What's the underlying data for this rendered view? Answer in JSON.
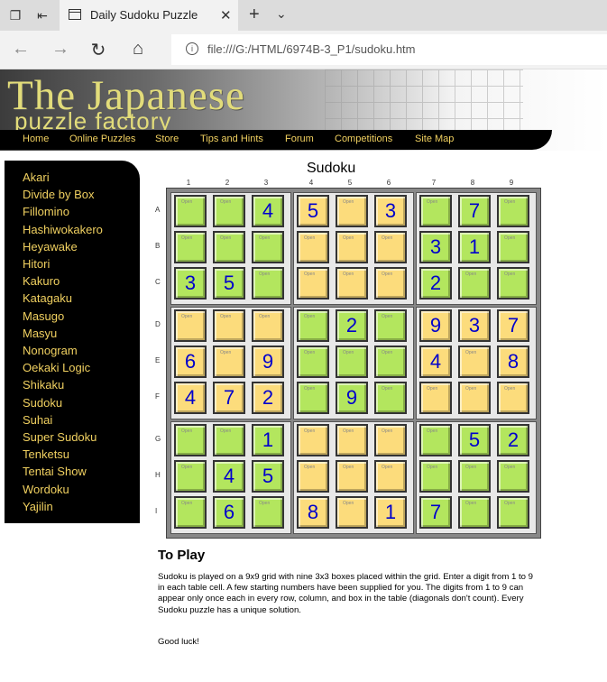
{
  "browser": {
    "tab_title": "Daily Sudoku Puzzle",
    "url": "file:///G:/HTML/6974B-3_P1/sudoku.htm",
    "icons": [
      "tab-actions-icon",
      "set-aside-tabs-icon",
      "page-icon",
      "close-icon",
      "plus-icon",
      "chevron-down-icon",
      "back-arrow-icon",
      "forward-arrow-icon",
      "refresh-icon",
      "home-icon",
      "info-icon"
    ]
  },
  "banner": {
    "title_line1": "The Japanese",
    "title_line2": "puzzle factory"
  },
  "menu": [
    "Home",
    "Online Puzzles",
    "Store",
    "Tips and Hints",
    "Forum",
    "Competitions",
    "Site Map"
  ],
  "sidebar": {
    "items": [
      "Akari",
      "Divide by Box",
      "Fillomino",
      "Hashiwokakero",
      "Heyawake",
      "Hitori",
      "Kakuro",
      "Katagaku",
      "Masugo",
      "Masyu",
      "Nonogram",
      "Oekaki Logic",
      "Shikaku",
      "Sudoku",
      "Suhai",
      "Super Sudoku",
      "Tenketsu",
      "Tentai Show",
      "Wordoku",
      "Yajilin"
    ]
  },
  "puzzle": {
    "title": "Sudoku",
    "column_headers": [
      "1",
      "2",
      "3",
      "4",
      "5",
      "6",
      "7",
      "8",
      "9"
    ],
    "row_headers": [
      "A",
      "B",
      "C",
      "D",
      "E",
      "F",
      "G",
      "H",
      "I"
    ],
    "cell_marker": "Open",
    "colors": {
      "green": "#b3e65e",
      "yellow": "#fcdc7c",
      "digit": "#0000cc"
    },
    "grid": [
      [
        "",
        "",
        "4",
        "5",
        "",
        "3",
        "",
        "7",
        ""
      ],
      [
        "",
        "",
        "",
        "",
        "",
        "",
        "3",
        "1",
        ""
      ],
      [
        "3",
        "5",
        "",
        "",
        "",
        "",
        "2",
        "",
        ""
      ],
      [
        "",
        "",
        "",
        "",
        "2",
        "",
        "9",
        "3",
        "7"
      ],
      [
        "6",
        "",
        "9",
        "",
        "",
        "",
        "4",
        "",
        "8"
      ],
      [
        "4",
        "7",
        "2",
        "",
        "9",
        "",
        "",
        "",
        ""
      ],
      [
        "",
        "",
        "1",
        "",
        "",
        "",
        "",
        "5",
        "2"
      ],
      [
        "",
        "4",
        "5",
        "",
        "",
        "",
        "",
        "",
        ""
      ],
      [
        "",
        "6",
        "",
        "8",
        "",
        "1",
        "7",
        "",
        ""
      ]
    ]
  },
  "content": {
    "heading": "To Play",
    "paragraph": "Sudoku is played on a 9x9 grid with nine 3x3 boxes placed within the grid. Enter a digit from 1 to 9 in each table cell. A few starting numbers have been supplied for you. The digits from 1 to 9 can appear only once each in every row, column, and box in the table (diagonals don't count). Every Sudoku puzzle has a unique solution.",
    "closing": "Good luck!"
  }
}
